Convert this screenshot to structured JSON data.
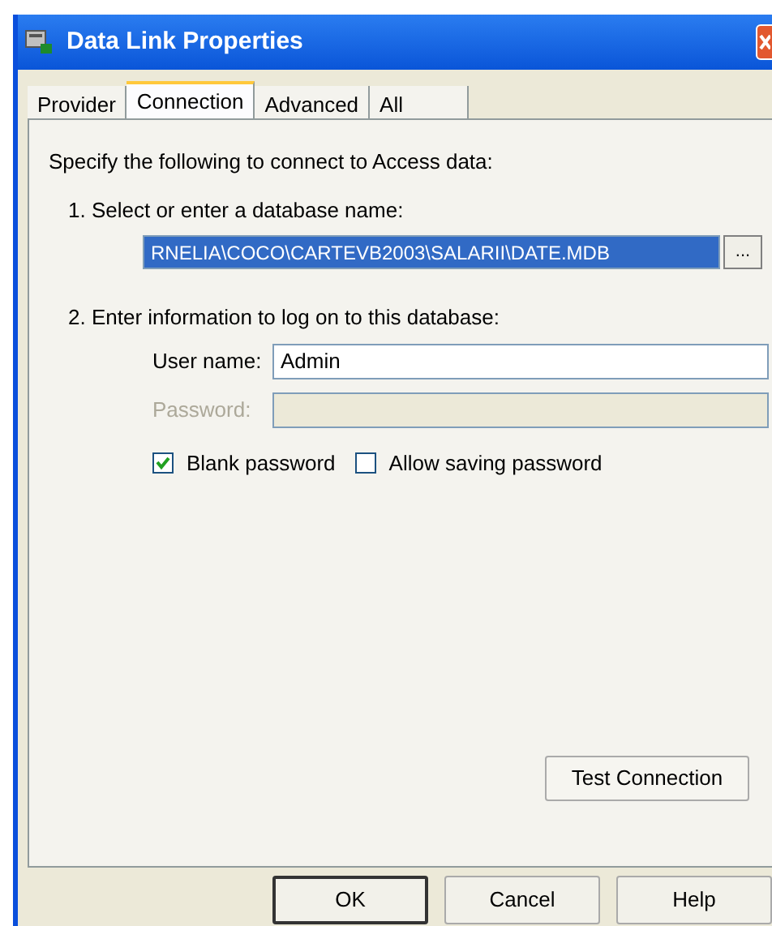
{
  "window": {
    "title": "Data Link Properties"
  },
  "tabs": [
    {
      "label": "Provider",
      "selected": false
    },
    {
      "label": "Connection",
      "selected": true
    },
    {
      "label": "Advanced",
      "selected": false
    },
    {
      "label": "All",
      "selected": false
    }
  ],
  "intro": "Specify the following to connect to Access data:",
  "step1": {
    "label": "1. Select or enter a database name:",
    "value": "RNELIA\\COCO\\CARTEVB2003\\SALARII\\DATE.MDB",
    "browse": "..."
  },
  "step2": {
    "label": "2. Enter information to log on to this database:",
    "user": {
      "label": "User name:",
      "value": "Admin",
      "disabled": false
    },
    "password": {
      "label": "Password:",
      "disabled": true
    }
  },
  "checkboxes": [
    {
      "label": "Blank password",
      "checked": true
    },
    {
      "label": "Allow saving password",
      "checked": false
    }
  ],
  "test_button": "Test Connection",
  "buttons": [
    {
      "label": "OK",
      "default": true
    },
    {
      "label": "Cancel",
      "default": false
    },
    {
      "label": "Help",
      "default": false
    }
  ]
}
